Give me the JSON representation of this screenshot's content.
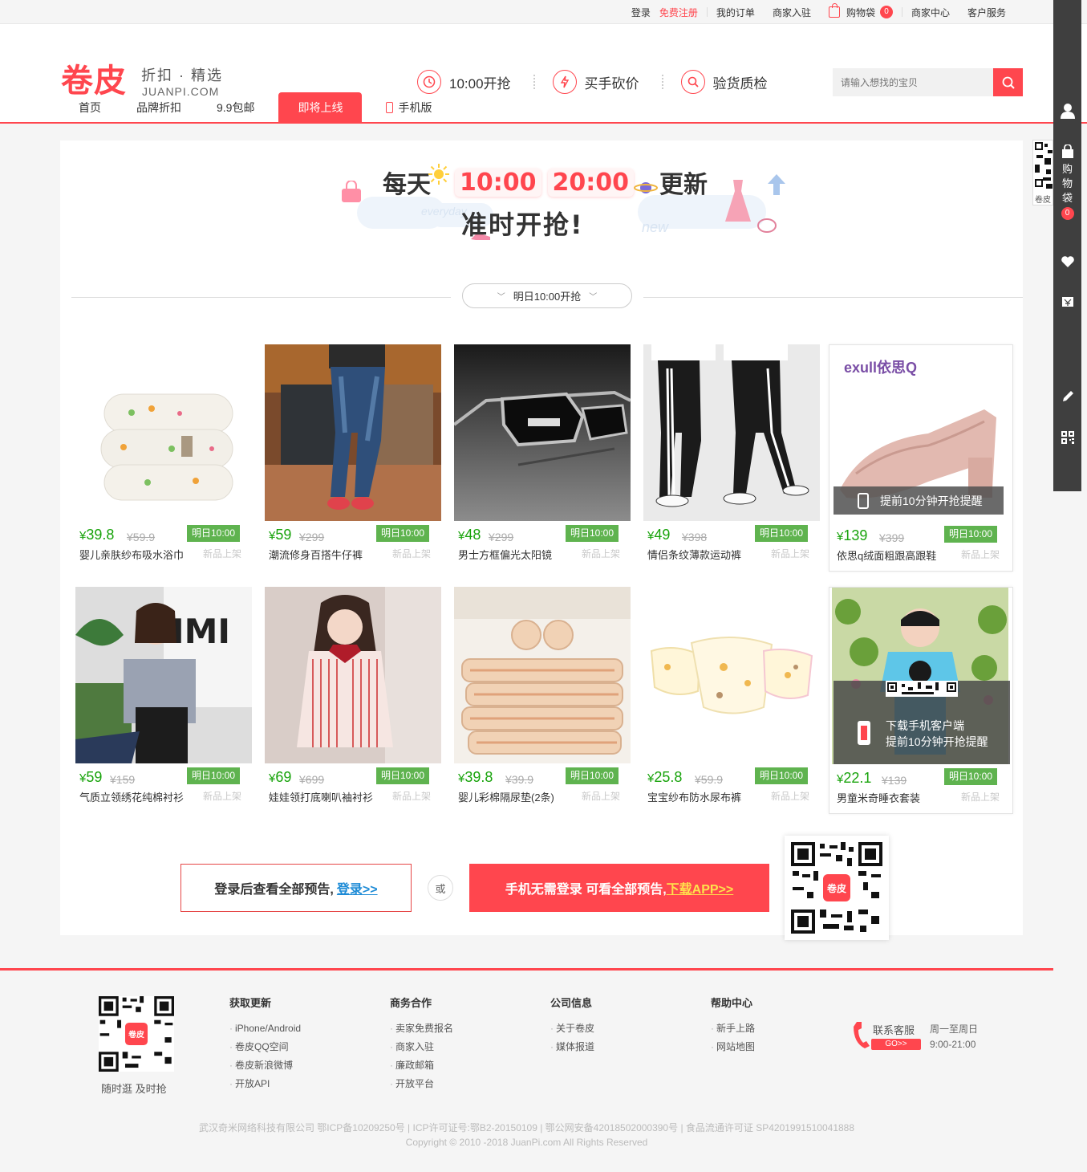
{
  "topbar": {
    "login": "登录",
    "register": "免费注册",
    "orders": "我的订单",
    "merchant_join": "商家入驻",
    "cart": "购物袋",
    "cart_count": "0",
    "merchant_center": "商家中心",
    "customer_service": "客户服务"
  },
  "header": {
    "logo": "卷皮",
    "slogan": "折扣 · 精选",
    "domain": "JUANPI.COM",
    "features": [
      "10:00开抢",
      "买手砍价",
      "验货质检"
    ],
    "search_placeholder": "请输入想找的宝贝"
  },
  "nav": {
    "items": [
      "首页",
      "品牌折扣",
      "9.9包邮",
      "即将上线",
      "手机版"
    ]
  },
  "banner": {
    "daily": "每天",
    "time1": "10:00",
    "time2": "20:00",
    "update": "更新",
    "ontime": "准时开抢!",
    "everyday": "everyday",
    "new": "new"
  },
  "filter": {
    "label": "明日10:00开抢"
  },
  "products": [
    {
      "price": "39.8",
      "old": "¥59.9",
      "tag": "明日10:00",
      "name": "婴儿亲肤纱布吸水浴巾",
      "status": "新品上架"
    },
    {
      "price": "59",
      "old": "¥299",
      "tag": "明日10:00",
      "name": "潮流修身百搭牛仔裤",
      "status": "新品上架"
    },
    {
      "price": "48",
      "old": "¥299",
      "tag": "明日10:00",
      "name": "男士方框偏光太阳镜",
      "status": "新品上架"
    },
    {
      "price": "49",
      "old": "¥398",
      "tag": "明日10:00",
      "name": "情侣条纹薄款运动裤",
      "status": "新品上架"
    },
    {
      "price": "139",
      "old": "¥399",
      "tag": "明日10:00",
      "name": "依思q绒面粗跟高跟鞋",
      "status": "新品上架",
      "brand": "exull依思Q",
      "remind": "提前10分钟开抢提醒"
    },
    {
      "price": "59",
      "old": "¥159",
      "tag": "明日10:00",
      "name": "气质立领绣花纯棉衬衫",
      "status": "新品上架"
    },
    {
      "price": "69",
      "old": "¥699",
      "tag": "明日10:00",
      "name": "娃娃领打底喇叭袖衬衫",
      "status": "新品上架"
    },
    {
      "price": "39.8",
      "old": "¥39.9",
      "tag": "明日10:00",
      "name": "婴儿彩棉隔尿垫(2条)",
      "status": "新品上架"
    },
    {
      "price": "25.8",
      "old": "¥59.9",
      "tag": "明日10:00",
      "name": "宝宝纱布防水尿布裤",
      "status": "新品上架"
    },
    {
      "price": "22.1",
      "old": "¥139",
      "tag": "明日10:00",
      "name": "男童米奇睡衣套装",
      "status": "新品上架",
      "download": "下载手机客户端",
      "remind": "提前10分钟开抢提醒"
    }
  ],
  "currency": "¥",
  "cta": {
    "login_text": "登录后查看全部预告,",
    "login_link": "登录>>",
    "or": "或",
    "app_text": "手机无需登录 可看全部预告,",
    "app_link": "下载APP>>",
    "qr_logo": "卷皮"
  },
  "footer": {
    "qr_caption": "随时逛 及时抢",
    "columns": [
      {
        "title": "获取更新",
        "items": [
          "iPhone/Android",
          "卷皮QQ空间",
          "卷皮新浪微博",
          "开放API"
        ]
      },
      {
        "title": "商务合作",
        "items": [
          "卖家免费报名",
          "商家入驻",
          "廉政邮箱",
          "开放平台"
        ]
      },
      {
        "title": "公司信息",
        "items": [
          "关于卷皮",
          "媒体报道"
        ]
      },
      {
        "title": "帮助中心",
        "items": [
          "新手上路",
          "网站地图"
        ]
      }
    ],
    "service_label": "联系客服",
    "service_go": "GO>>",
    "service_days": "周一至周日",
    "service_hours": "9:00-21:00",
    "license": "武汉奇米网络科技有限公司 鄂ICP备10209250号 | ICP许可证号:鄂B2-20150109 | 鄂公网安备42018502000390号 | 食品流通许可证 SP4201991510041888",
    "copyright": "Copyright © 2010 -2018 JuanPi.com All Rights Reserved"
  },
  "sidebar": {
    "bag_label": "购物袋",
    "bag_count": "0",
    "qr_caption": "卷皮"
  },
  "colors": {
    "brand": "#ff464e",
    "price": "#18a30b",
    "tag": "#5fb34f"
  }
}
